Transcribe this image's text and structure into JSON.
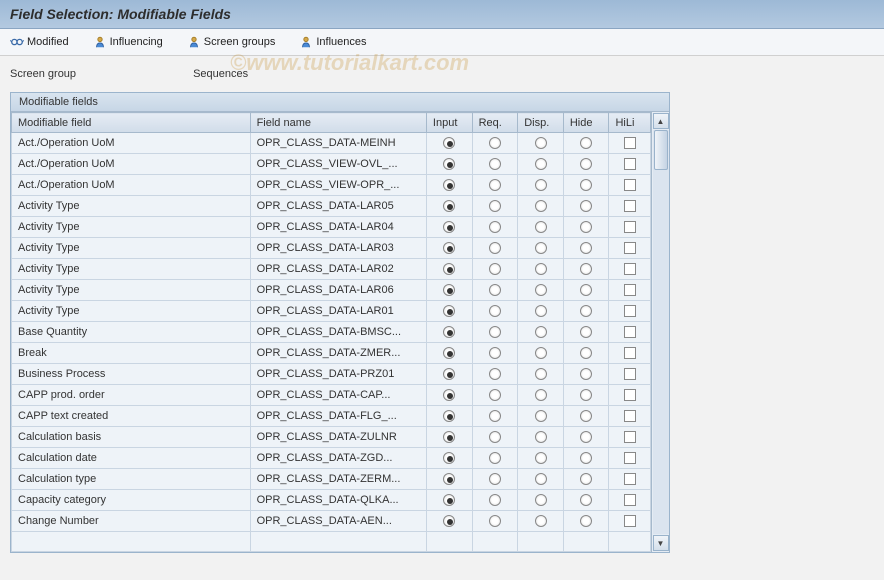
{
  "header": {
    "title": "Field Selection: Modifiable Fields"
  },
  "toolbar": {
    "modified": "Modified",
    "influencing": "Influencing",
    "screen_groups": "Screen groups",
    "influences": "Influences"
  },
  "content_top": {
    "label_screen_group": "Screen group",
    "value_screen_group": "Sequences"
  },
  "table": {
    "title": "Modifiable fields",
    "columns": {
      "modifiable_field": "Modifiable field",
      "field_name": "Field name",
      "input": "Input",
      "req": "Req.",
      "disp": "Disp.",
      "hide": "Hide",
      "hili": "HiLi"
    },
    "rows": [
      {
        "modfield": "Act./Operation UoM",
        "fieldname": "OPR_CLASS_DATA-MEINH",
        "sel": 0
      },
      {
        "modfield": "Act./Operation UoM",
        "fieldname": "OPR_CLASS_VIEW-OVL_...",
        "sel": 0
      },
      {
        "modfield": "Act./Operation UoM",
        "fieldname": "OPR_CLASS_VIEW-OPR_...",
        "sel": 0
      },
      {
        "modfield": "Activity Type",
        "fieldname": "OPR_CLASS_DATA-LAR05",
        "sel": 0
      },
      {
        "modfield": "Activity Type",
        "fieldname": "OPR_CLASS_DATA-LAR04",
        "sel": 0
      },
      {
        "modfield": "Activity Type",
        "fieldname": "OPR_CLASS_DATA-LAR03",
        "sel": 0
      },
      {
        "modfield": "Activity Type",
        "fieldname": "OPR_CLASS_DATA-LAR02",
        "sel": 0
      },
      {
        "modfield": "Activity Type",
        "fieldname": "OPR_CLASS_DATA-LAR06",
        "sel": 0
      },
      {
        "modfield": "Activity Type",
        "fieldname": "OPR_CLASS_DATA-LAR01",
        "sel": 0
      },
      {
        "modfield": "Base Quantity",
        "fieldname": "OPR_CLASS_DATA-BMSC...",
        "sel": 0
      },
      {
        "modfield": "Break",
        "fieldname": "OPR_CLASS_DATA-ZMER...",
        "sel": 0
      },
      {
        "modfield": "Business Process",
        "fieldname": "OPR_CLASS_DATA-PRZ01",
        "sel": 0
      },
      {
        "modfield": "CAPP prod. order",
        "fieldname": "OPR_CLASS_DATA-CAP...",
        "sel": 0
      },
      {
        "modfield": "CAPP text created",
        "fieldname": "OPR_CLASS_DATA-FLG_...",
        "sel": 0
      },
      {
        "modfield": "Calculation basis",
        "fieldname": "OPR_CLASS_DATA-ZULNR",
        "sel": 0
      },
      {
        "modfield": "Calculation date",
        "fieldname": "OPR_CLASS_DATA-ZGD...",
        "sel": 0
      },
      {
        "modfield": "Calculation type",
        "fieldname": "OPR_CLASS_DATA-ZERM...",
        "sel": 0
      },
      {
        "modfield": "Capacity category",
        "fieldname": "OPR_CLASS_DATA-QLKA...",
        "sel": 0
      },
      {
        "modfield": "Change Number",
        "fieldname": "OPR_CLASS_DATA-AEN...",
        "sel": 0
      }
    ]
  },
  "watermark": "©www.tutorialkart.com"
}
